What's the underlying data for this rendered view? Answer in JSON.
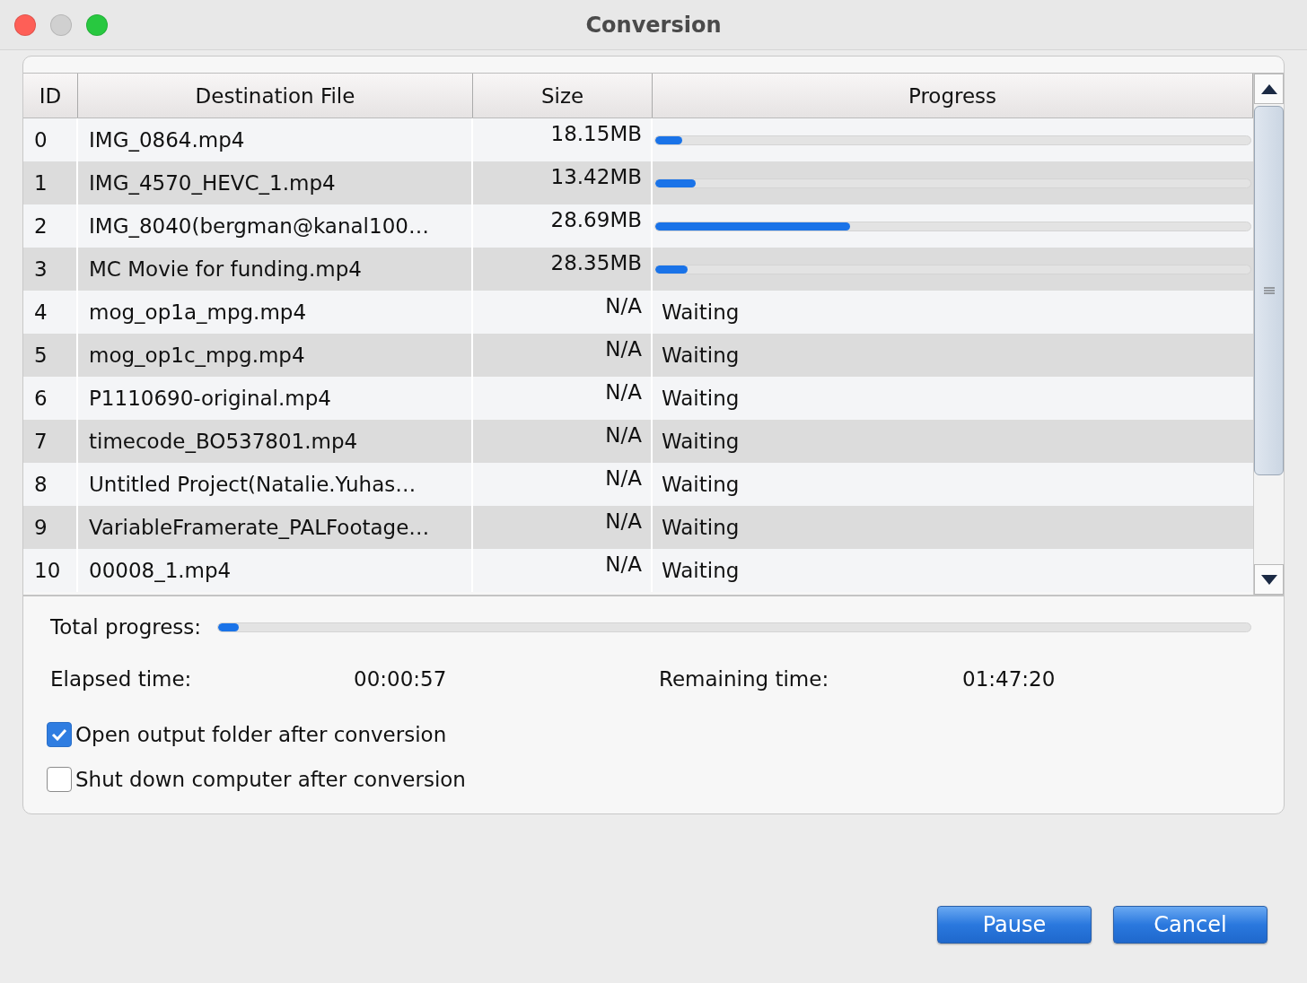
{
  "window": {
    "title": "Conversion"
  },
  "table": {
    "columns": [
      "ID",
      "Destination File",
      "Size",
      "Progress"
    ],
    "rows": [
      {
        "id": "0",
        "file": "IMG_0864.mp4",
        "size": "18.15MB",
        "kind": "bar",
        "level": 0.045
      },
      {
        "id": "1",
        "file": "IMG_4570_HEVC_1.mp4",
        "size": "13.42MB",
        "kind": "bar",
        "level": 0.068
      },
      {
        "id": "2",
        "file": "IMG_8040(bergman@kanal100…",
        "size": "28.69MB",
        "kind": "bar",
        "level": 0.327
      },
      {
        "id": "3",
        "file": "MC Movie for funding.mp4",
        "size": "28.35MB",
        "kind": "bar",
        "level": 0.055
      },
      {
        "id": "4",
        "file": "mog_op1a_mpg.mp4",
        "size": "N/A",
        "kind": "status",
        "status": "Waiting"
      },
      {
        "id": "5",
        "file": "mog_op1c_mpg.mp4",
        "size": "N/A",
        "kind": "status",
        "status": "Waiting"
      },
      {
        "id": "6",
        "file": "P1110690-original.mp4",
        "size": "N/A",
        "kind": "status",
        "status": "Waiting"
      },
      {
        "id": "7",
        "file": "timecode_BO537801.mp4",
        "size": "N/A",
        "kind": "status",
        "status": "Waiting"
      },
      {
        "id": "8",
        "file": "Untitled Project(Natalie.Yuhas…",
        "size": "N/A",
        "kind": "status",
        "status": "Waiting"
      },
      {
        "id": "9",
        "file": "VariableFramerate_PALFootage…",
        "size": "N/A",
        "kind": "status",
        "status": "Waiting"
      },
      {
        "id": "10",
        "file": "00008_1.mp4",
        "size": "N/A",
        "kind": "status",
        "status": "Waiting"
      }
    ]
  },
  "total_progress": {
    "label": "Total progress:",
    "level": 0.02
  },
  "elapsed": {
    "label": "Elapsed time:",
    "value": "00:00:57"
  },
  "remaining": {
    "label": "Remaining time:",
    "value": "01:47:20"
  },
  "options": [
    {
      "label": "Open output folder after conversion",
      "checked": true
    },
    {
      "label": "Shut down computer after conversion",
      "checked": false
    }
  ],
  "buttons": [
    "Pause",
    "Cancel"
  ]
}
